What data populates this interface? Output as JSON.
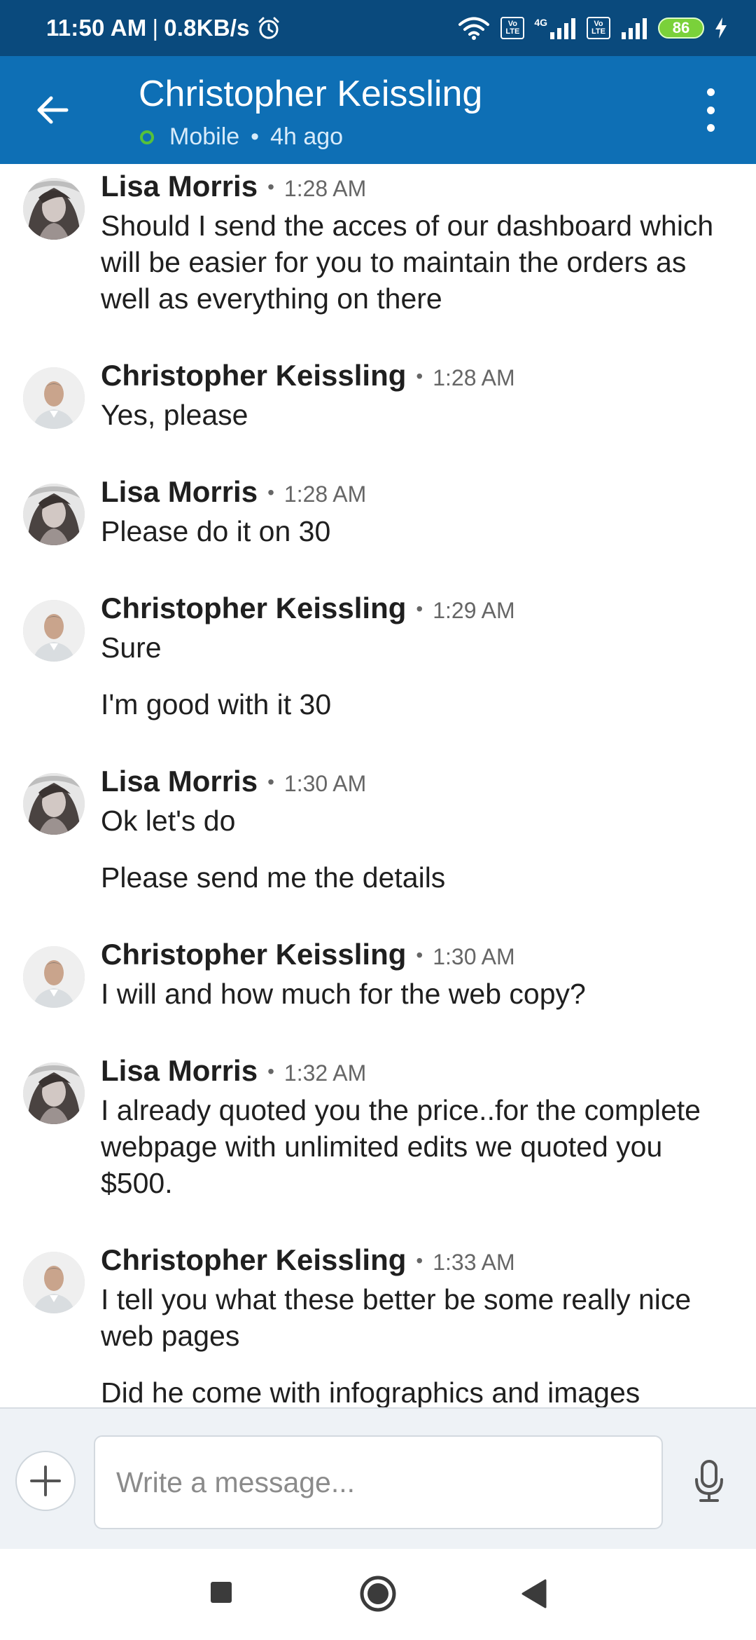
{
  "status_bar": {
    "time": "11:50 AM",
    "separator": "|",
    "speed": "0.8KB/s",
    "volte1": [
      "Vo",
      "LTE"
    ],
    "network": "4G",
    "volte2": [
      "Vo",
      "LTE"
    ],
    "battery": "86"
  },
  "header": {
    "title": "Christopher Keissling",
    "status": "Mobile",
    "separator": "•",
    "last_seen": "4h ago"
  },
  "messages": [
    {
      "sender": "Lisa Morris",
      "time": "1:28 AM",
      "texts": [
        "Should I send the acces of our dashboard which will be easier for you to maintain the orders as well as everything on there"
      ]
    },
    {
      "sender": "Christopher Keissling",
      "time": "1:28 AM",
      "texts": [
        "Yes, please"
      ]
    },
    {
      "sender": "Lisa Morris",
      "time": "1:28 AM",
      "texts": [
        "Please do it on 30"
      ]
    },
    {
      "sender": "Christopher Keissling",
      "time": "1:29 AM",
      "texts": [
        "Sure",
        "I'm good with it 30"
      ]
    },
    {
      "sender": "Lisa Morris",
      "time": "1:30 AM",
      "texts": [
        "Ok let's do",
        "Please send me the details"
      ]
    },
    {
      "sender": "Christopher Keissling",
      "time": "1:30 AM",
      "texts": [
        "I will and how much for the web copy?"
      ]
    },
    {
      "sender": "Lisa Morris",
      "time": "1:32 AM",
      "texts": [
        "I already quoted you the price..for the complete webpage with unlimited edits we quoted you $500."
      ]
    },
    {
      "sender": "Christopher Keissling",
      "time": "1:33 AM",
      "texts": [
        "I tell you what these better be some really nice web pages",
        "Did he come with infographics and images"
      ]
    }
  ],
  "message_separator": "•",
  "composer": {
    "placeholder": "Write a message..."
  },
  "colors": {
    "status_bar": "#0a4a7d",
    "header": "#0e6fb5",
    "online": "#56c13b",
    "battery": "#7ad13a"
  },
  "icons": {
    "back": "arrow-left-icon",
    "more": "more-vertical-icon",
    "add": "plus-icon",
    "mic": "microphone-icon",
    "nav_recents": "square-icon",
    "nav_home": "circle-icon",
    "nav_back": "triangle-back-icon"
  }
}
